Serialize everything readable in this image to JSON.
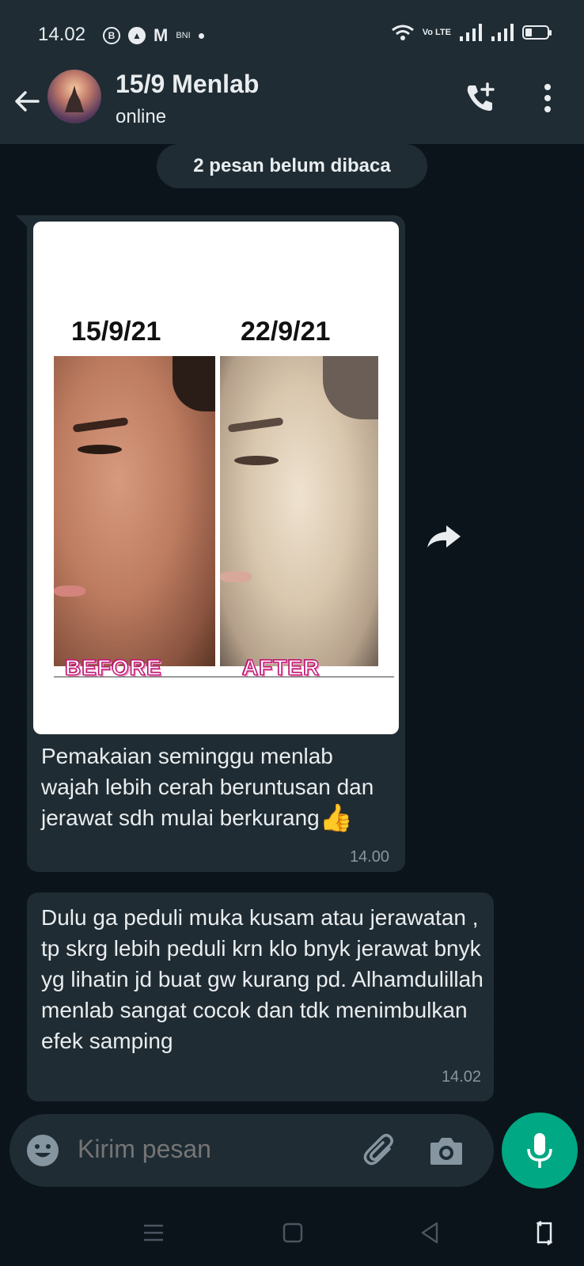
{
  "status_bar": {
    "time": "14.02",
    "left_icons": [
      "b-circle-icon",
      "up-circle-icon",
      "gmail-icon",
      "bni-icon",
      "dot-icon"
    ],
    "m_label": "M",
    "bni_label": "BNI",
    "volte_label": "Vo LTE",
    "right_icons": [
      "wifi-icon",
      "signal-icon",
      "signal-icon",
      "battery-icon"
    ]
  },
  "header": {
    "title": "15/9 Menlab",
    "subtitle": "online"
  },
  "unread_banner": "2 pesan belum dibaca",
  "messages": [
    {
      "type": "image",
      "image": {
        "left_date": "15/9/21",
        "right_date": "22/9/21",
        "left_label": "BEFORE",
        "right_label": "AFTER"
      },
      "text": "Pemakaian seminggu menlab wajah lebih cerah beruntusan dan jerawat sdh mulai berkurang",
      "emoji": "👍",
      "time": "14.00"
    },
    {
      "type": "text",
      "text": "Dulu ga peduli muka kusam atau jerawatan , tp skrg lebih peduli krn klo bnyk jerawat bnyk yg lihatin jd buat gw kurang pd. Alhamdulillah menlab sangat cocok dan tdk menimbulkan efek samping",
      "time": "14.02"
    }
  ],
  "input": {
    "placeholder": "Kirim pesan"
  },
  "colors": {
    "background": "#0b141a",
    "bar": "#1f2c34",
    "bubble": "#202c33",
    "accent": "#00a884",
    "meta_text": "#8696a0"
  }
}
